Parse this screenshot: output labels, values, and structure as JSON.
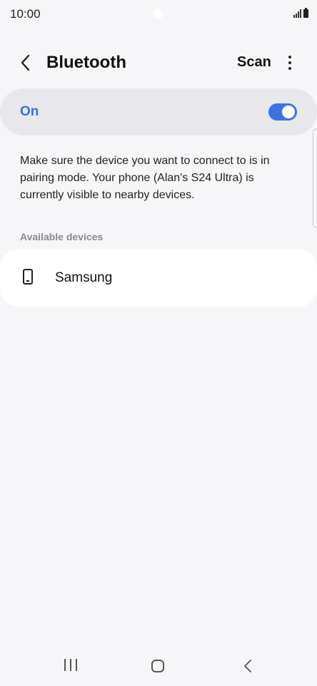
{
  "status_bar": {
    "time": "10:00"
  },
  "header": {
    "title": "Bluetooth",
    "scan_label": "Scan",
    "back_icon": "chevron-left-icon",
    "more_icon": "more-vertical-icon"
  },
  "bluetooth_toggle": {
    "label": "On",
    "state": true,
    "accent_color": "#3d73e0"
  },
  "info": {
    "message": "Make sure the device you want to connect to is in pairing mode. Your phone (Alan's S24 Ultra) is currently visible to nearby devices."
  },
  "available_devices": {
    "header": "Available devices",
    "items": [
      {
        "name": "Samsung",
        "icon": "smartphone-icon"
      }
    ]
  },
  "nav_bar": {
    "recents_icon": "recents-icon",
    "home_icon": "home-icon",
    "back_icon": "back-icon"
  }
}
